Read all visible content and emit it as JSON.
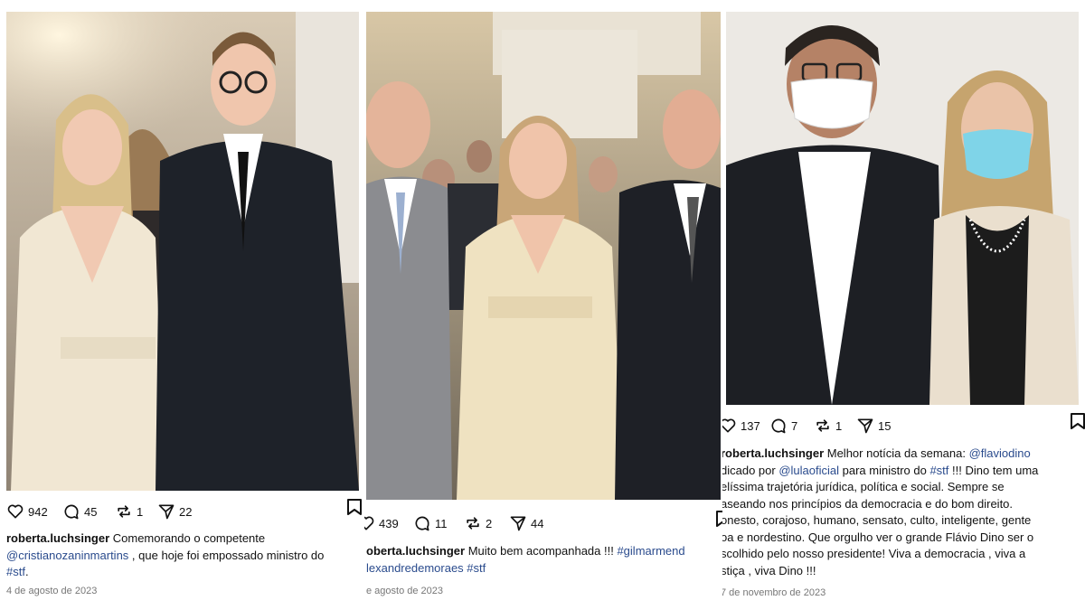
{
  "posts": [
    {
      "likes": "942",
      "comments": "45",
      "reposts": "1",
      "shares": "22",
      "username": "roberta.luchsinger",
      "caption_line1": " Comemorando o competente",
      "mention": "@cristianozaninmartins",
      "caption_line2": " , que hoje foi empossado ministro do",
      "hashtag": "#stf",
      "caption_end": ".",
      "date": "4 de agosto de 2023"
    },
    {
      "likes": "439",
      "comments": "11",
      "reposts": "2",
      "shares": "44",
      "username": "oberta.luchsinger",
      "caption_line1": " Muito bem acompanhada !!! ",
      "mention1": "#gilmarmend",
      "mention2": "lexandredemoraes",
      "hashtag": " #stf",
      "date": "e agosto de 2023"
    },
    {
      "likes": "137",
      "comments": "7",
      "reposts": "1",
      "shares": "15",
      "username": "roberta.luchsinger",
      "caption_line1": " Melhor notícia da semana: ",
      "mention1": "@flaviodino",
      "l2_pre": "dicado por ",
      "mention2": "@lulaoficial",
      "l2_mid": " para ministro do ",
      "hashtag": "#stf",
      "l2_post": " !!! Dino tem uma",
      "line3": "elíssima trajetória jurídica, política e social.  Sempre se",
      "line4": "aseando nos princípios da democracia e do bom direito.",
      "line5": "onesto, corajoso, humano, sensato, culto, inteligente, gente",
      "line6": "oa e nordestino. Que orgulho ver o grande Flávio Dino ser o",
      "line7": "scolhido pelo nosso presidente! Viva a democracia , viva a",
      "line8": "stiça , viva Dino !!!",
      "date": "7 de novembro de 2023"
    }
  ],
  "colors": {
    "link": "#2a4b8d",
    "meta": "#777777",
    "text": "#111111"
  },
  "icons": [
    "heart-icon",
    "comment-icon",
    "repost-icon",
    "share-icon",
    "bookmark-icon"
  ]
}
